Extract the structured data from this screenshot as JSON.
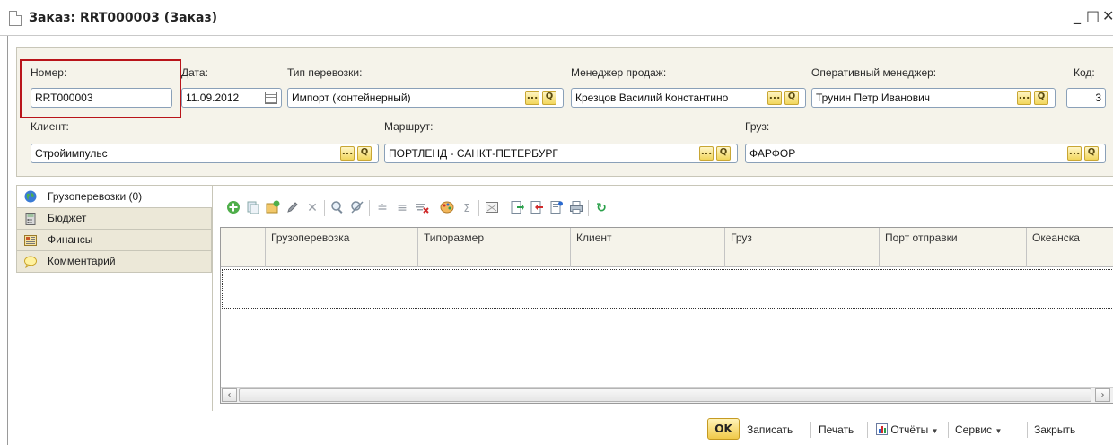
{
  "window": {
    "title": "Заказ: RRT000003 (Заказ)",
    "minimize": "_",
    "maximize": "□",
    "close": "✕"
  },
  "form": {
    "number": {
      "label": "Номер:",
      "value": "RRT000003"
    },
    "date": {
      "label": "Дата:",
      "value": "11.09.2012"
    },
    "transport_type": {
      "label": "Тип перевозки:",
      "value": "Импорт (контейнерный)"
    },
    "sales_manager": {
      "label": "Менеджер продаж:",
      "value": "Крезцов  Василий Константино"
    },
    "operational_manager": {
      "label": "Оперативный менеджер:",
      "value": "Трунин Петр Иванович"
    },
    "code": {
      "label": "Код:",
      "value": "3"
    },
    "client": {
      "label": "Клиент:",
      "value": "Стройимпульс"
    },
    "route": {
      "label": "Маршрут:",
      "value": "ПОРТЛЕНД - САНКТ-ПЕТЕРБУРГ"
    },
    "cargo": {
      "label": "Груз:",
      "value": "ФАРФОР"
    },
    "dots_label": "...",
    "search_glyph": "Q"
  },
  "tabs": [
    {
      "label": "Грузоперевозки (0)",
      "icon": "globe-icon",
      "active": true
    },
    {
      "label": "Бюджет",
      "icon": "calculator-icon",
      "active": false
    },
    {
      "label": "Финансы",
      "icon": "finance-icon",
      "active": false
    },
    {
      "label": "Комментарий",
      "icon": "comment-icon",
      "active": false
    }
  ],
  "toolbar": {
    "icons": [
      "add-icon",
      "copy-icon",
      "add-group-icon",
      "edit-icon",
      "delete-icon",
      "find-icon",
      "cancel-find-icon",
      "sort-asc-icon",
      "filter-icon",
      "clear-filter-icon",
      "palette-icon",
      "sum-icon",
      "report-icon",
      "export-icon",
      "import-icon",
      "attach-icon",
      "print-icon",
      "refresh-icon"
    ]
  },
  "grid": {
    "columns": [
      "Грузоперевозка",
      "Типоразмер",
      "Клиент",
      "Груз",
      "Порт отправки",
      "Океанска"
    ],
    "rows": []
  },
  "footer": {
    "ok": "OK",
    "save": "Записать",
    "print": "Печать",
    "reports": "Отчёты",
    "service": "Сервис",
    "close": "Закрыть"
  },
  "colors": {
    "highlight": "#b9141a",
    "panel": "#f5f3ea",
    "button": "#f0c94a"
  }
}
